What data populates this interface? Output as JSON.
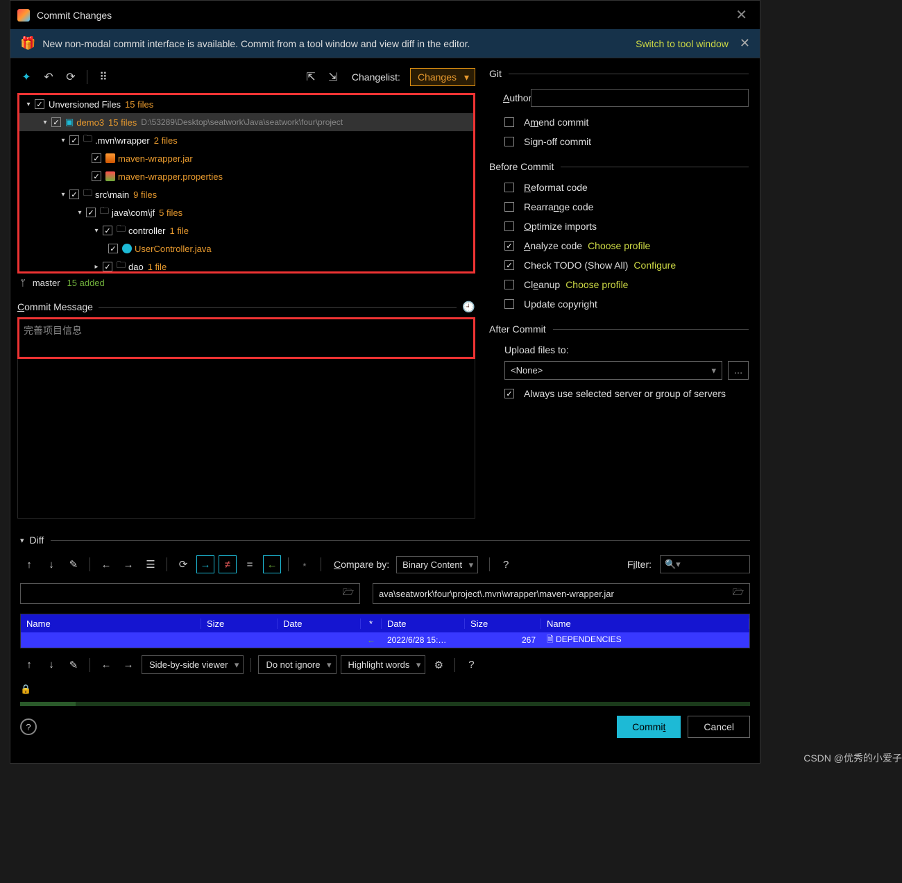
{
  "titlebar": {
    "title": "Commit Changes"
  },
  "banner": {
    "text": "New non-modal commit interface is available. Commit from a tool window and view diff in the editor.",
    "link": "Switch to tool window"
  },
  "toolbar": {
    "changelist_label": "Changelist:",
    "changelist_value": "Changes"
  },
  "tree": {
    "root_label": "Unversioned Files",
    "root_count": "15 files",
    "demo_label": "demo3",
    "demo_count": "15 files",
    "demo_path": "D:\\53289\\Desktop\\seatwork\\Java\\seatwork\\four\\project",
    "mvn_label": ".mvn\\wrapper",
    "mvn_count": "2 files",
    "jar_label": "maven-wrapper.jar",
    "prop_label": "maven-wrapper.properties",
    "src_label": "src\\main",
    "src_count": "9 files",
    "java_label": "java\\com\\jf",
    "java_count": "5 files",
    "ctrl_label": "controller",
    "ctrl_count": "1 file",
    "uc_label": "UserController.java",
    "dao_label": "dao",
    "dao_count": "1 file"
  },
  "status": {
    "branch": "master",
    "added": "15 added"
  },
  "commit_msg": {
    "label": "Commit Message",
    "value": "完善项目信息"
  },
  "git": {
    "title": "Git",
    "author_label": "Author:",
    "amend": "Amend commit",
    "signoff": "Sign-off commit"
  },
  "before": {
    "title": "Before Commit",
    "reformat": "Reformat code",
    "rearrange": "Rearrange code",
    "optimize": "Optimize imports",
    "analyze": "Analyze code",
    "analyze_link": "Choose profile",
    "todo": "Check TODO (Show All)",
    "todo_link": "Configure",
    "cleanup": "Cleanup",
    "cleanup_link": "Choose profile",
    "copyright": "Update copyright"
  },
  "after": {
    "title": "After Commit",
    "upload_label": "Upload files to:",
    "upload_value": "<None>",
    "always": "Always use selected server or group of servers"
  },
  "diff": {
    "title": "Diff",
    "compare_label": "Compare by:",
    "compare_value": "Binary Content",
    "filter_label": "Filter:",
    "path_right": "ava\\seatwork\\four\\project\\.mvn\\wrapper\\maven-wrapper.jar",
    "header_name": "Name",
    "header_size": "Size",
    "header_date": "Date",
    "header_star": "*",
    "row_date": "2022/6/28 15:…",
    "row_size": "267",
    "row_name": "DEPENDENCIES",
    "viewer": "Side-by-side viewer",
    "ignore": "Do not ignore",
    "highlight": "Highlight words"
  },
  "buttons": {
    "commit": "Commit",
    "cancel": "Cancel"
  },
  "watermark": "CSDN @优秀的小爱子"
}
